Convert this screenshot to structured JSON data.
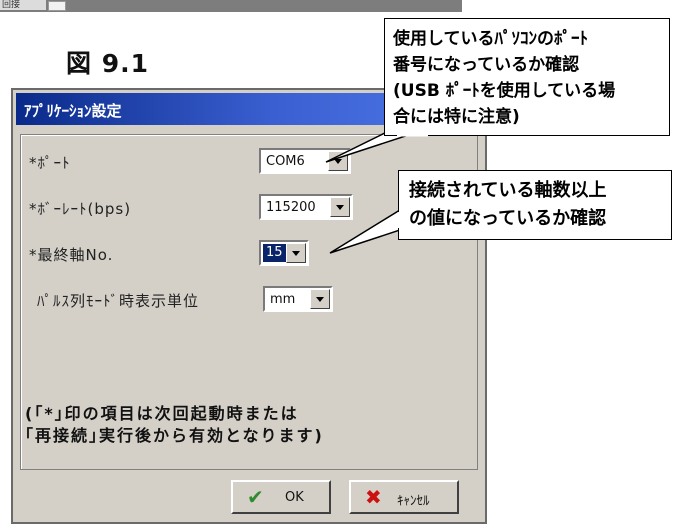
{
  "topstrip": {
    "tab_label": "回接"
  },
  "figure": {
    "label": "図 9.1"
  },
  "dialog": {
    "title": "ｱﾌﾟﾘｹｰｼｮﾝ設定",
    "rows": [
      {
        "label": "*ﾎﾟｰﾄ",
        "value": "COM6"
      },
      {
        "label": "*ﾎﾞｰﾚｰﾄ(bps)",
        "value": "115200"
      },
      {
        "label": "*最終軸No.",
        "value": "15"
      },
      {
        "label": "ﾊﾟﾙｽ列ﾓｰﾄﾞ時表示単位",
        "value": "mm"
      }
    ],
    "note_line1": "(｢*｣印の項目は次回起動時または",
    "note_line2": "｢再接続｣実行後から有効となります)",
    "ok_label": "OK",
    "cancel_label": "ｷｬﾝｾﾙ"
  },
  "callouts": {
    "port": {
      "line1": "使用しているﾊﾟｿｺﾝのﾎﾟｰﾄ",
      "line2": "番号になっているか確認",
      "line3": "(USB ﾎﾟｰﾄを使用している場",
      "line4": "合には特に注意)"
    },
    "axis": {
      "line1": "接続されている軸数以上",
      "line2": "の値になっているか確認"
    }
  },
  "colors": {
    "titlebar": "#0a2a8a",
    "dialog_bg": "#d4d0c8",
    "ok_check": "#2e8b2e",
    "cancel_x": "#cc1111"
  }
}
